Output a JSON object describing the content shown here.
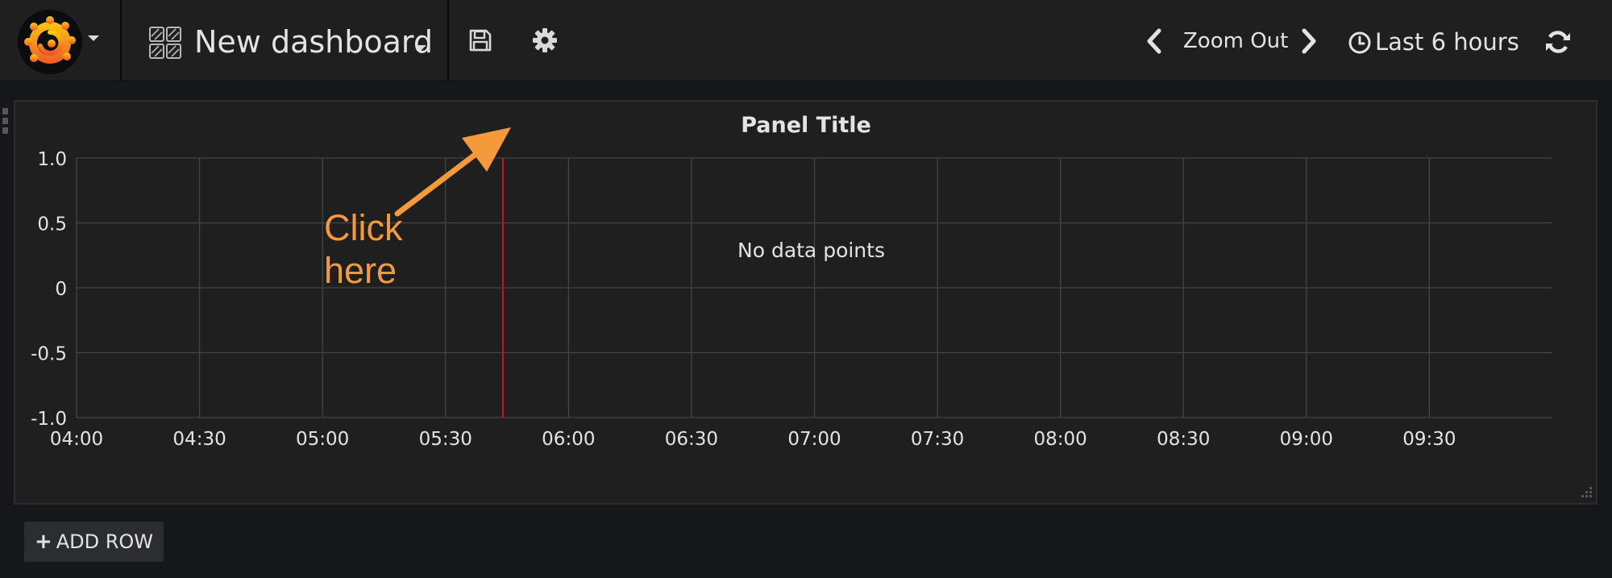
{
  "navbar": {
    "dashboard_title": "New dashboard",
    "zoom_label": "Zoom Out",
    "time_range_label": "Last 6 hours",
    "icons": [
      "grafana-logo-icon",
      "caret-down-icon",
      "dashboard-grid-icon",
      "save-icon",
      "gear-icon",
      "chevron-left-icon",
      "chevron-right-icon",
      "clock-icon",
      "refresh-icon"
    ]
  },
  "panel": {
    "title": "Panel Title",
    "no_data_text": "No data points"
  },
  "annotation": {
    "line1": "Click",
    "line2": "here",
    "color": "#f49a3a"
  },
  "add_row": {
    "plus": "+",
    "label": "ADD ROW"
  },
  "colors": {
    "background": "#161719",
    "panel": "#1f1f20",
    "accent": "#f49a3a",
    "now_marker": "#c4161c",
    "grid": "#444548"
  },
  "chart_data": {
    "type": "line",
    "title": "Panel Title",
    "xlabel": "",
    "ylabel": "",
    "x_ticks": [
      "04:00",
      "04:30",
      "05:00",
      "05:30",
      "06:00",
      "06:30",
      "07:00",
      "07:30",
      "08:00",
      "08:30",
      "09:00",
      "09:30"
    ],
    "y_ticks": [
      "1.0",
      "0.5",
      "0",
      "-0.5",
      "-1.0"
    ],
    "ylim": [
      -1.0,
      1.0
    ],
    "xlim": [
      "04:00",
      "09:59"
    ],
    "now_marker": "05:44",
    "series": [],
    "grid": true,
    "message": "No data points"
  }
}
